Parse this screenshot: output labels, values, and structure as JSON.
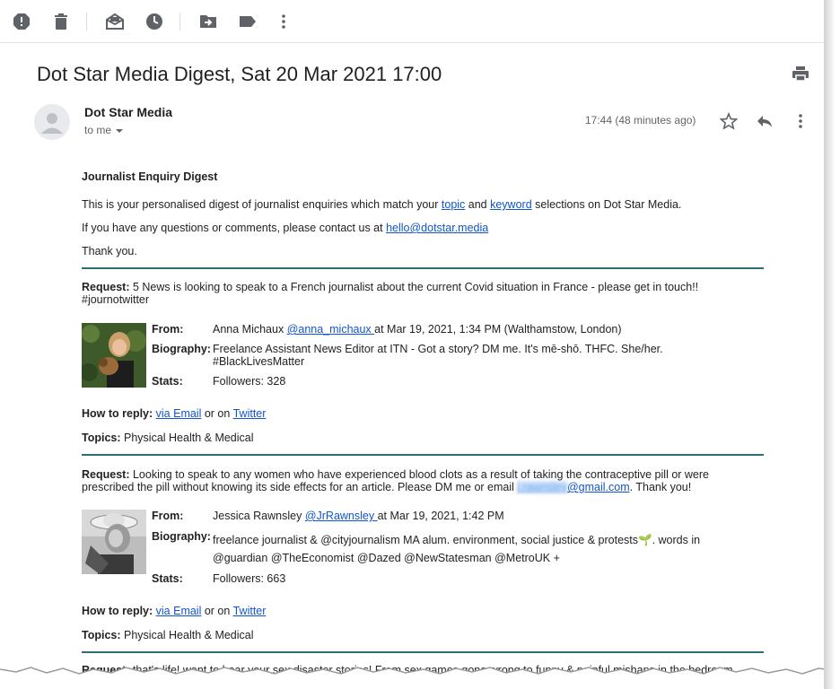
{
  "toolbar": {
    "icons": [
      "report-spam-icon",
      "delete-icon",
      "mark-unread-icon",
      "snooze-icon",
      "move-to-icon",
      "label-icon",
      "more-icon"
    ]
  },
  "email": {
    "subject": "Dot Star Media Digest, Sat 20 Mar 2021 17:00",
    "sender": "Dot Star Media",
    "to": "to me",
    "time": "17:44 (48 minutes ago)"
  },
  "body": {
    "heading": "Journalist Enquiry Digest",
    "intro_a": "This is your personalised digest of journalist enquiries which match your ",
    "intro_topic": "topic",
    "intro_and": " and ",
    "intro_keyword": "keyword",
    "intro_b": " selections on Dot Star Media.",
    "contact_a": "If you have any questions or comments, please contact us at ",
    "contact_email": "hello@dotstar.media",
    "thanks": "Thank you."
  },
  "labels": {
    "request": "Request:",
    "from": "From:",
    "biography": "Biography:",
    "stats": "Stats:",
    "how_to_reply": "How to reply:",
    "via_email": "via Email",
    "or_on": " or on ",
    "twitter": "Twitter",
    "topics": "Topics:"
  },
  "requests": [
    {
      "text": " 5 News is looking to speak to a French journalist about the current Covid situation in France - please get in touch!! #journotwitter",
      "name": "Anna Michaux ",
      "handle": "@anna_michaux ",
      "when": "at Mar 19, 2021, 1:34 PM (Walthamstow, London)",
      "bio": "Freelance Assistant News Editor at ITN - Got a story? DM me. It's mē-shō. THFC. She/her. #BlackLivesMatter",
      "stats": "Followers: 328",
      "topics": " Physical Health & Medical"
    },
    {
      "text_a": " Looking to speak to any women who have experienced blood clots as a result of taking the contraceptive pill or were prescribed the pill without knowing its side effects for an article. Please DM me or email ",
      "email_blur": "j.rawnsley",
      "email_domain": "@gmail.com",
      "text_b": ". Thank you!",
      "name": "Jessica Rawnsley ",
      "handle": "@JrRawnsley ",
      "when": "at Mar 19, 2021, 1:42 PM",
      "bio_a": "freelance journalist & @cityjournalism MA alum. environment, social justice & protests",
      "bio_emoji": "🌱",
      "bio_b": ". words in @guardian @TheEconomist @Dazed @NewStatesman @MetroUK +",
      "stats": "Followers: 663",
      "topics": " Physical Health & Medical"
    },
    {
      "text": " that's life! want to hear your sex disaster stories! From sex games gone wrong to funny & painful mishaps in the bedroom"
    }
  ]
}
